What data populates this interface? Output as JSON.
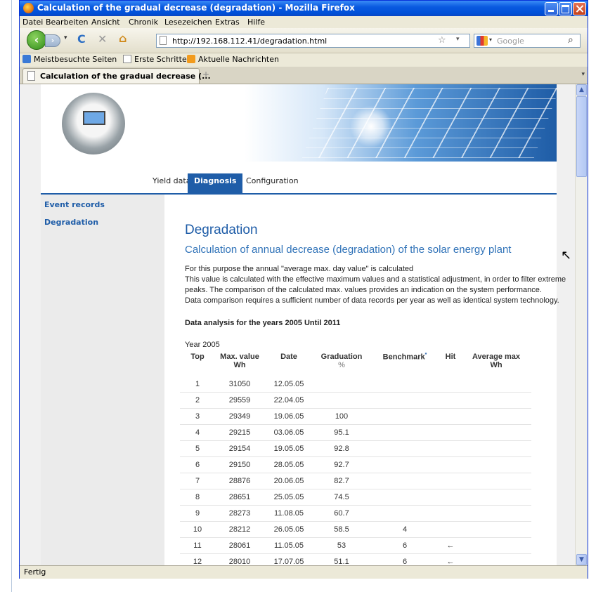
{
  "window": {
    "title": "Calculation of the gradual decrease (degradation) - Mozilla Firefox"
  },
  "menu": [
    "Datei",
    "Bearbeiten",
    "Ansicht",
    "Chronik",
    "Lesezeichen",
    "Extras",
    "Hilfe"
  ],
  "navbar": {
    "url": "http://192.168.112.41/degradation.html",
    "search_placeholder": "Google"
  },
  "bookmarks": [
    "Meistbesuchte Seiten",
    "Erste Schritte",
    "Aktuelle Nachrichten"
  ],
  "tab": {
    "label": "Calculation of the gradual decrease (...",
    "new_tab": "+"
  },
  "page": {
    "nav_tabs": [
      "Yield data",
      "Diagnosis",
      "Configuration"
    ],
    "sidebar": [
      "Event records",
      "Degradation"
    ],
    "heading": "Degradation",
    "subheading": "Calculation of annual decrease (degradation) of the solar energy plant",
    "paragraphs": [
      "For this purpose the annual \"average max. day value\" is calculated",
      "This value is calculated with the effective maximum values and a statistical adjustment, in order to filter extreme",
      "peaks. The comparison of the calculated max. values provides an indication on the system performance.",
      "Data comparison requires a sufficient number of data records per year as well as identical system technology."
    ],
    "analysis_title": "Data analysis for the years 2005 Until 2011",
    "year_label": "Year 2005",
    "table": {
      "headers": {
        "top": "Top",
        "max_value": "Max. value",
        "max_value_unit": "Wh",
        "date": "Date",
        "graduation": "Graduation",
        "graduation_unit": "%",
        "benchmark": "Benchmark",
        "benchmark_mark": "*",
        "hit": "Hit",
        "average_max": "Average max",
        "average_max_unit": "Wh"
      },
      "rows": [
        [
          "1",
          "31050",
          "12.05.05",
          "",
          "",
          "",
          ""
        ],
        [
          "2",
          "29559",
          "22.04.05",
          "",
          "",
          "",
          ""
        ],
        [
          "3",
          "29349",
          "19.06.05",
          "100",
          "",
          "",
          ""
        ],
        [
          "4",
          "29215",
          "03.06.05",
          "95.1",
          "",
          "",
          ""
        ],
        [
          "5",
          "29154",
          "19.05.05",
          "92.8",
          "",
          "",
          ""
        ],
        [
          "6",
          "29150",
          "28.05.05",
          "92.7",
          "",
          "",
          ""
        ],
        [
          "7",
          "28876",
          "20.06.05",
          "82.7",
          "",
          "",
          ""
        ],
        [
          "8",
          "28651",
          "25.05.05",
          "74.5",
          "",
          "",
          ""
        ],
        [
          "9",
          "28273",
          "11.08.05",
          "60.7",
          "",
          "",
          ""
        ],
        [
          "10",
          "28212",
          "26.05.05",
          "58.5",
          "4",
          "",
          ""
        ],
        [
          "11",
          "28061",
          "11.05.05",
          "53",
          "6",
          "←",
          ""
        ],
        [
          "12",
          "28010",
          "17.07.05",
          "51.1",
          "6",
          "←",
          ""
        ]
      ]
    }
  },
  "status": "Fertig"
}
